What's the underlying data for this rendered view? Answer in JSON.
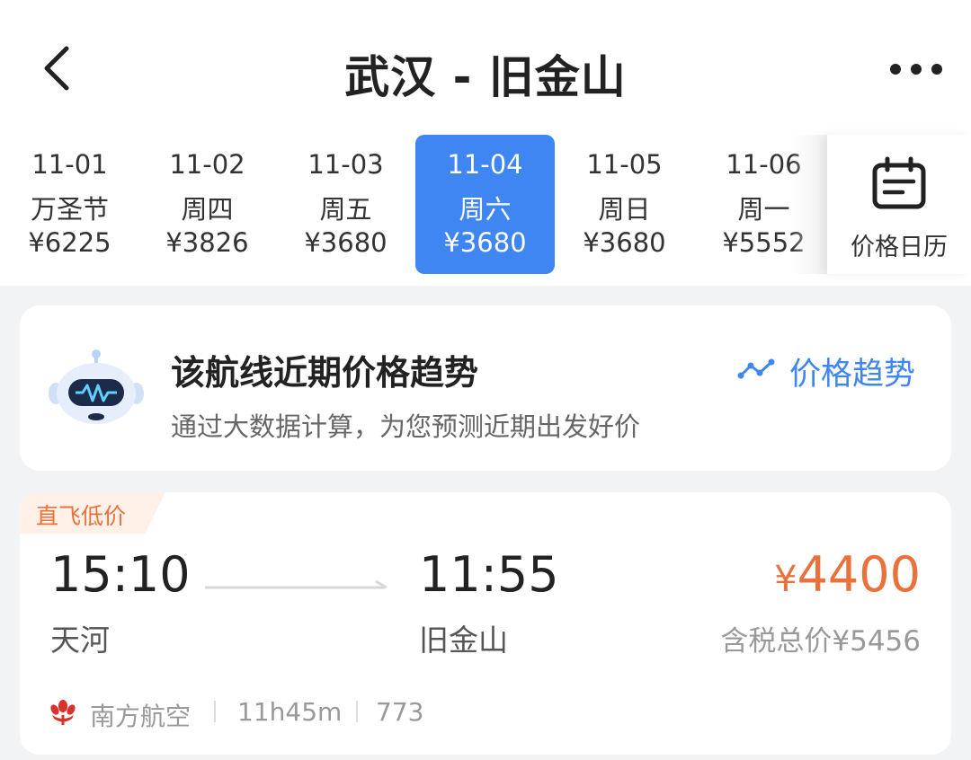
{
  "header": {
    "title": "武汉 - 旧金山",
    "back_icon": "chevron-left-icon",
    "more_icon": "more-dots-icon"
  },
  "date_strip": {
    "items": [
      {
        "date": "11-01",
        "label": "万圣节",
        "price": "¥6225",
        "selected": false
      },
      {
        "date": "11-02",
        "label": "周四",
        "price": "¥3826",
        "selected": false
      },
      {
        "date": "11-03",
        "label": "周五",
        "price": "¥3680",
        "selected": false
      },
      {
        "date": "11-04",
        "label": "周六",
        "price": "¥3680",
        "selected": true
      },
      {
        "date": "11-05",
        "label": "周日",
        "price": "¥3680",
        "selected": false
      },
      {
        "date": "11-06",
        "label": "周一",
        "price": "¥5552",
        "selected": false
      }
    ],
    "calendar_label": "价格日历",
    "calendar_icon": "calendar-icon"
  },
  "trend_card": {
    "title": "该航线近期价格趋势",
    "subtitle": "通过大数据计算，为您预测近期出发好价",
    "link_label": "价格趋势",
    "link_icon": "trend-line-icon",
    "mascot_icon": "robot-icon"
  },
  "flight": {
    "tag": "直飞低价",
    "departure_time": "15:10",
    "departure_airport": "天河",
    "arrival_time": "11:55",
    "arrival_airport": "旧金山",
    "price_symbol": "¥",
    "price_value": "4400",
    "total_price": "含税总价¥5456",
    "airline": "南方航空",
    "airline_icon": "china-southern-logo-icon",
    "duration": "11h45m",
    "flight_number": "773"
  },
  "colors": {
    "accent": "#3f86f2",
    "price": "#e8713c",
    "background": "#f2f3f5"
  }
}
